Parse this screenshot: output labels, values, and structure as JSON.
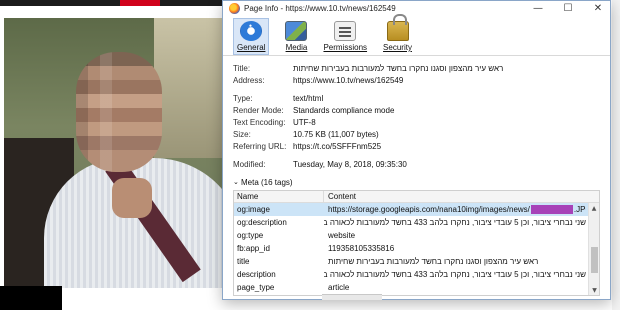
{
  "window": {
    "title": "Page Info - https://www.10.tv/news/162549",
    "controls": {
      "minimize": "—",
      "maximize": "☐",
      "close": "✕"
    }
  },
  "toolbar": {
    "tabs": [
      {
        "label": "General",
        "icon": "info-icon",
        "active": true
      },
      {
        "label": "Media",
        "icon": "media-icon",
        "active": false
      },
      {
        "label": "Permissions",
        "icon": "permissions-icon",
        "active": false
      },
      {
        "label": "Security",
        "icon": "lock-icon",
        "active": false
      }
    ]
  },
  "general": {
    "title_label": "Title:",
    "title_value": "ראש עיר מהצפון וסגנו נחקרו בחשד למעורבות בעבירות שחיתות",
    "address_label": "Address:",
    "address_value": "https://www.10.tv/news/162549",
    "type_label": "Type:",
    "type_value": "text/html",
    "render_label": "Render Mode:",
    "render_value": "Standards compliance mode",
    "encoding_label": "Text Encoding:",
    "encoding_value": "UTF-8",
    "size_label": "Size:",
    "size_value": "10.75 KB (11,007 bytes)",
    "referring_label": "Referring URL:",
    "referring_value": "https://t.co/5SFFFnm525",
    "modified_label": "Modified:",
    "modified_value": "Tuesday, May 8, 2018, 09:35:30"
  },
  "meta": {
    "heading": "Meta (16 tags)",
    "columns": [
      "Name",
      "Content"
    ],
    "rows": [
      {
        "name": "og:image",
        "content_pre": "https://storage.googleapis.com/nana10img/images/news/",
        "content_post": ".JPG"
      },
      {
        "name": "og:description",
        "content": "שני נבחרי ציבור, וכן 5 עובדי ציבור, נחקרו בלהב 433 בחשד למעורבות לכאורה ב..."
      },
      {
        "name": "og:type",
        "content": "website"
      },
      {
        "name": "fb:app_id",
        "content": "119358105335816"
      },
      {
        "name": "title",
        "content": "ראש עיר מהצפון וסגנו נחקרו בחשד למעורבות בעבירות שחיתות"
      },
      {
        "name": "description",
        "content": "שני נבחרי ציבור, וכן 5 עובדי ציבור, נחקרו בלהב 433 בחשד למעורבות לכאורה ב..."
      },
      {
        "name": "page_type",
        "content": "article"
      }
    ]
  },
  "colors": {
    "selection": "#cce4f7",
    "redaction": "#a742b8",
    "dialog_border": "#8aa6c8"
  }
}
